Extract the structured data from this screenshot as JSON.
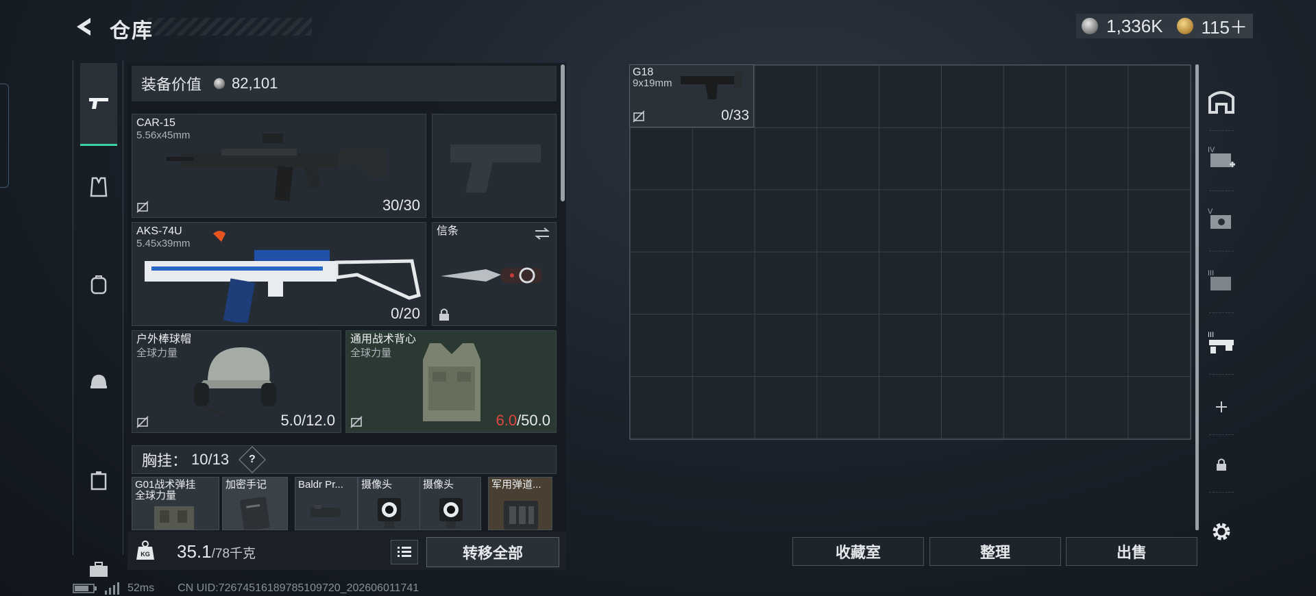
{
  "header": {
    "title": "仓库",
    "currency_silver": "1,336K",
    "currency_gold": "115＋"
  },
  "equip": {
    "label": "装备价值",
    "value": "82,101"
  },
  "slots": [
    {
      "name": "CAR-15",
      "sub": "5.56x45mm",
      "count": "30/30"
    },
    {
      "name": "AKS-74U",
      "sub": "5.45x39mm",
      "count": "0/20"
    },
    {
      "name": "信条",
      "sub": "",
      "count": ""
    },
    {
      "name": "户外棒球帽",
      "sub": "全球力量",
      "count": "5.0/12.0"
    },
    {
      "name": "通用战术背心",
      "sub": "全球力量",
      "count_low": "6.0",
      "count_max": "/50.0"
    }
  ],
  "chest": {
    "label": "胸挂：",
    "value": "10/13",
    "help": "?"
  },
  "chest_items": [
    {
      "name": "G01战术弹挂",
      "sub": "全球力量"
    },
    {
      "name": "加密手记"
    },
    {
      "name": "Baldr Pr..."
    },
    {
      "name": "摄像头"
    },
    {
      "name": "摄像头"
    },
    {
      "name": "军用弹道..."
    }
  ],
  "weight": {
    "current": "35.1",
    "max": "/78千克"
  },
  "buttons": {
    "transfer": "转移全部",
    "collection": "收藏室",
    "organize": "整理",
    "sell": "出售"
  },
  "storage_item": {
    "name": "G18",
    "sub": "9x19mm",
    "count": "0/33"
  },
  "status": {
    "ping": "52ms",
    "uid": "CN UID:7267451618978510972​0_202606011741"
  },
  "colors": {
    "accent": "#3ed0a8",
    "warning": "#e0453f"
  },
  "icons": [
    "back-arrow-icon",
    "pistol-icon",
    "vest-icon",
    "backpack-icon",
    "helmet-icon",
    "case-icon",
    "toolbox-icon",
    "settings-icon",
    "lock-icon",
    "plus-icon",
    "swap-icon",
    "kg-icon",
    "list-icon"
  ]
}
